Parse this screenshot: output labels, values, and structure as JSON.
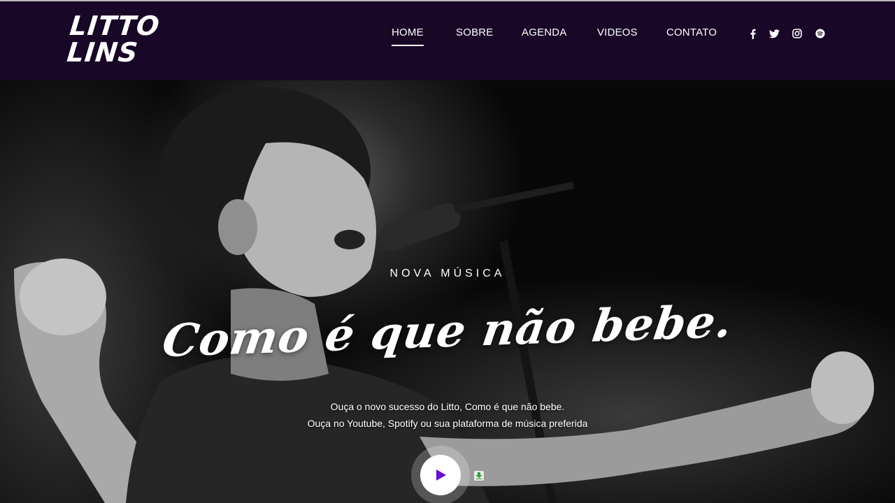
{
  "brand": {
    "logo_line1": "LITTO",
    "logo_line2": "LINS",
    "header_bg": "#180726"
  },
  "nav": {
    "items": [
      {
        "label": "HOME",
        "active": true
      },
      {
        "label": "SOBRE",
        "active": false
      },
      {
        "label": "AGENDA",
        "active": false
      },
      {
        "label": "VIDEOS",
        "active": false
      },
      {
        "label": "CONTATO",
        "active": false
      }
    ]
  },
  "social": {
    "icons": [
      "facebook-icon",
      "twitter-icon",
      "instagram-icon",
      "spotify-icon"
    ]
  },
  "hero": {
    "kicker": "NOVA MÚSICA",
    "title": "Como é que não bebe.",
    "description_line1": "Ouça o novo sucesso do Litto, Como é que não bebe.",
    "description_line2": "Ouça no Youtube, Spotify ou sua plataforma de música preferida",
    "play_icon": "play-icon",
    "accent_color": "#6a0dd8"
  }
}
